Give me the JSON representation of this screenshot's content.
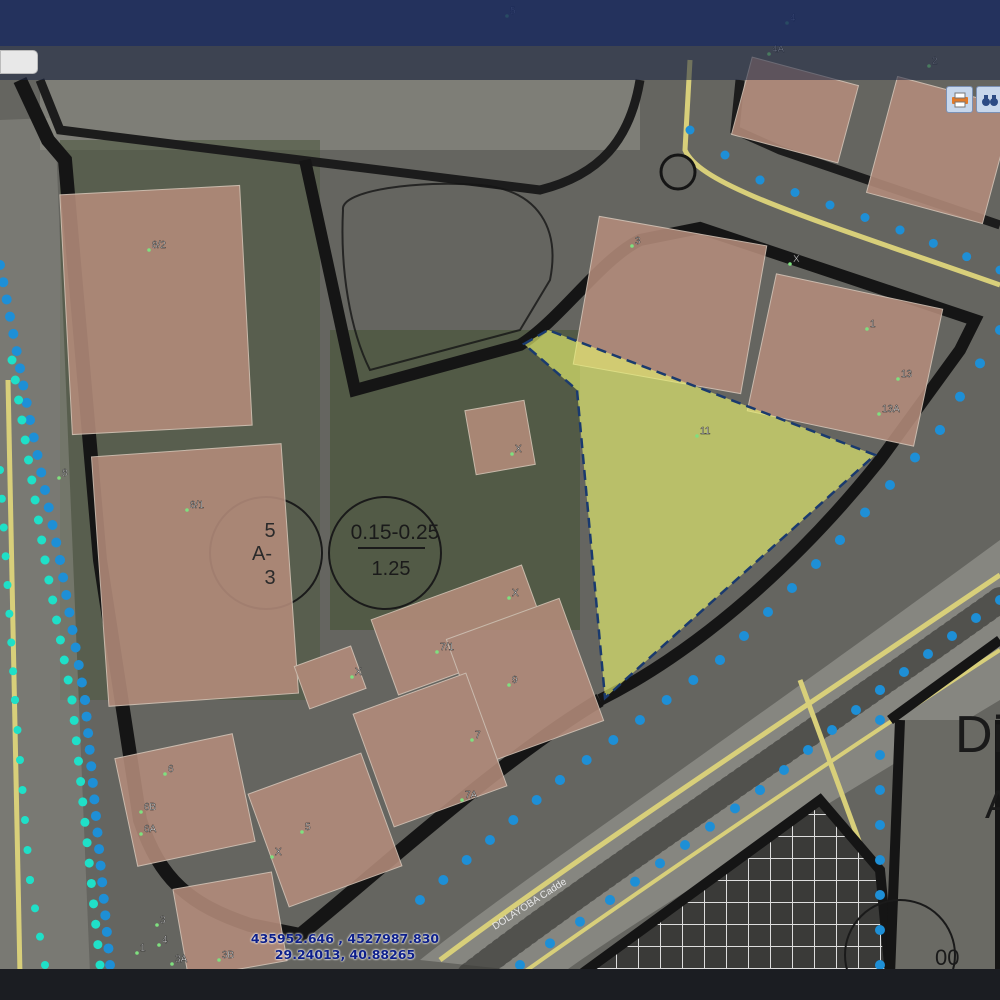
{
  "map": {
    "parcel_labels": [
      "8/2",
      "8/1",
      "8",
      "X",
      "7/1",
      "X",
      "X",
      "9",
      "7",
      "7A",
      "6",
      "6B",
      "6A",
      "5",
      "X",
      "3",
      "4",
      "3A",
      "3B",
      "1",
      "3",
      "X",
      "1",
      "13",
      "13A",
      "11",
      "5",
      "4",
      "4A",
      "2"
    ],
    "zone_a": {
      "top": "5",
      "mid": "A-",
      "bottom": "3"
    },
    "zone_b": {
      "top": "0.15-0.25",
      "bottom": "1.25"
    },
    "street_name": "DOLAYOBA Cadde",
    "edge_text": "Di",
    "edge_text2": "A",
    "edge_text3": "00"
  },
  "status": {
    "utm": "435952.646 , 4527987.830",
    "latlon": "29.24013, 40.88265"
  },
  "colors": {
    "toolbar": "#14265c",
    "highlight_fill": "#e6f06e",
    "highlight_border": "#1a3a6e",
    "coord_text": "#0d1f8a",
    "road_yellow": "#d8cf7a",
    "dot_blue": "#1e8fd6",
    "dot_cyan": "#1fe0c8"
  },
  "toolbar": {
    "print_icon": "print-icon",
    "binoculars_icon": "binoculars-icon"
  }
}
